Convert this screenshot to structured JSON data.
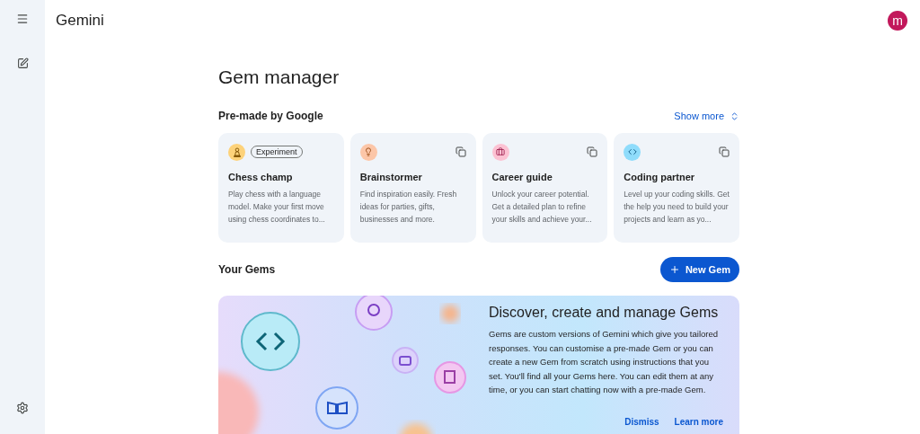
{
  "app": {
    "title": "Gemini",
    "avatar": "m"
  },
  "page": {
    "title": "Gem manager"
  },
  "premade": {
    "heading": "Pre-made by Google",
    "show_more": "Show more",
    "cards": [
      {
        "color": "#fdd27a",
        "badge": "Experiment",
        "title": "Chess champ",
        "description": "Play chess with a language model. Make your first move using chess coordinates to..."
      },
      {
        "color": "#fcc6a8",
        "title": "Brainstormer",
        "description": "Find inspiration easily. Fresh ideas for parties, gifts, businesses and more."
      },
      {
        "color": "#fcc2d3",
        "title": "Career guide",
        "description": "Unlock your career potential. Get a detailed plan to refine your skills and achieve your..."
      },
      {
        "color": "#8fdcfb",
        "title": "Coding partner",
        "description": "Level up your coding skills. Get the help you need to build your projects and learn as yo..."
      }
    ]
  },
  "your_gems": {
    "heading": "Your Gems",
    "new_button": "New Gem"
  },
  "banner": {
    "title": "Discover, create and manage Gems",
    "body": "Gems are custom versions of Gemini which give you tailored responses. You can customise a pre-made Gem or you can create a new Gem from scratch using instructions that you set. You'll find all your Gems here. You can edit them at any time, or you can start chatting now with a pre-made Gem.",
    "actions": [
      "Dismiss",
      "Learn more"
    ]
  }
}
